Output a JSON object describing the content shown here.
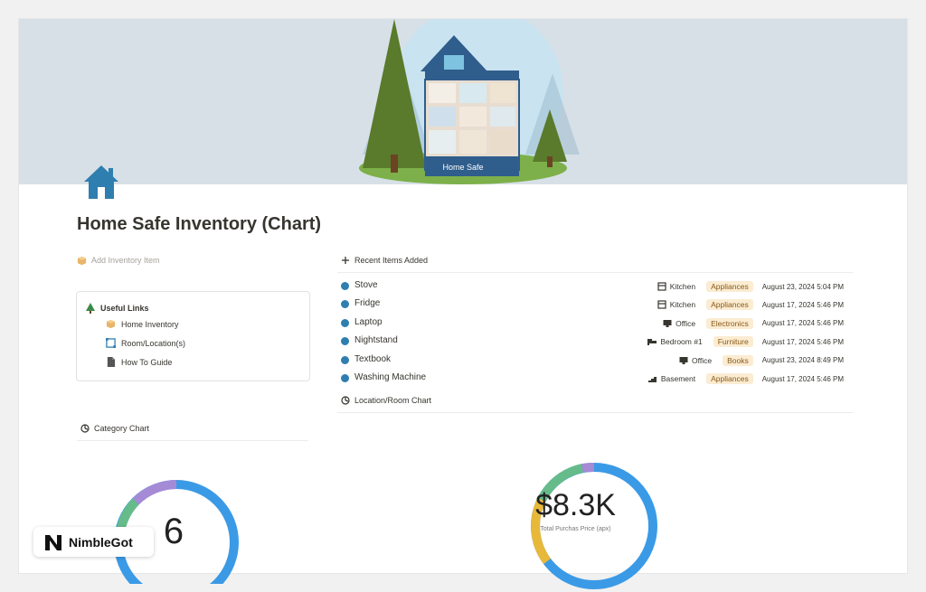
{
  "cover": {
    "caption": "Home Safe"
  },
  "page": {
    "title": "Home Safe Inventory (Chart)",
    "icon": "house-icon"
  },
  "add_button": {
    "label": "Add Inventory Item",
    "icon": "box-icon"
  },
  "useful_links": {
    "title": "Useful Links",
    "title_icon": "tree-icon",
    "items": [
      {
        "label": "Home Inventory",
        "icon": "box-icon"
      },
      {
        "label": "Room/Location(s)",
        "icon": "frame-icon"
      },
      {
        "label": "How To Guide",
        "icon": "document-icon"
      }
    ]
  },
  "recent_items": {
    "heading": "Recent Items Added",
    "heading_icon": "plus-icon",
    "rows": [
      {
        "name": "Stove",
        "room": "Kitchen",
        "room_icon": "oven-icon",
        "category": "Appliances",
        "date": "August 23, 2024 5:04 PM"
      },
      {
        "name": "Fridge",
        "room": "Kitchen",
        "room_icon": "oven-icon",
        "category": "Appliances",
        "date": "August 17, 2024 5:46 PM"
      },
      {
        "name": "Laptop",
        "room": "Office",
        "room_icon": "monitor-icon",
        "category": "Electronics",
        "date": "August 17, 2024 5:46 PM"
      },
      {
        "name": "Nightstand",
        "room": "Bedroom #1",
        "room_icon": "bed-icon",
        "category": "Furniture",
        "date": "August 17, 2024 5:46 PM"
      },
      {
        "name": "Textbook",
        "room": "Office",
        "room_icon": "monitor-icon",
        "category": "Books",
        "date": "August 23, 2024 8:49 PM"
      },
      {
        "name": "Washing Machine",
        "room": "Basement",
        "room_icon": "stairs-icon",
        "category": "Appliances",
        "date": "August 17, 2024 5:46 PM"
      }
    ],
    "dot_color": "#2f7eb0",
    "tag_color": "#fbecd2"
  },
  "location_chart": {
    "heading": "Location/Room Chart",
    "heading_icon": "chart-icon"
  },
  "category_chart": {
    "heading": "Category Chart",
    "heading_icon": "chart-icon",
    "center_value": "6"
  },
  "price_chart": {
    "center_value": "$8.3K",
    "caption": "Total Purchas Price (apx)"
  },
  "watermark": {
    "label": "NimbleGot"
  },
  "colors": {
    "donut_blue": "#3b9ae6",
    "donut_purple": "#a58ad6",
    "donut_green": "#66bb8a",
    "donut_yellow": "#e8b83b"
  }
}
